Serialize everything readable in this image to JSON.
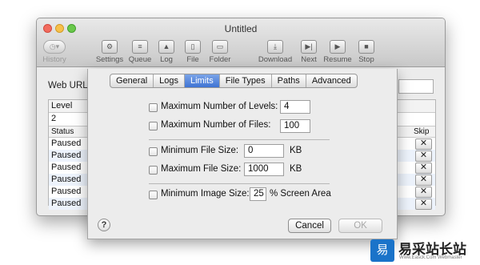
{
  "window": {
    "title": "Untitled"
  },
  "toolbar": {
    "history": "History",
    "settings": "Settings",
    "queue": "Queue",
    "log": "Log",
    "file": "File",
    "folder": "Folder",
    "download": "Download",
    "next": "Next",
    "resume": "Resume",
    "stop": "Stop"
  },
  "background": {
    "web_url_label": "Web URL:",
    "level_header": "Level",
    "level_value": "2",
    "status_header": "Status",
    "skip_header": "Skip",
    "rows": [
      "Paused",
      "Paused",
      "Paused",
      "Paused",
      "Paused",
      "Paused"
    ],
    "skip_glyph": "✕"
  },
  "sheet": {
    "tabs": [
      "General",
      "Logs",
      "Limits",
      "File Types",
      "Paths",
      "Advanced"
    ],
    "selected_tab": "Limits",
    "max_levels_label": "Maximum Number of Levels:",
    "max_levels_value": "4",
    "max_files_label": "Maximum Number of Files:",
    "max_files_value": "100",
    "min_file_size_label": "Minimum File Size:",
    "min_file_size_value": "0",
    "min_file_size_unit": "KB",
    "max_file_size_label": "Maximum File Size:",
    "max_file_size_value": "1000",
    "max_file_size_unit": "KB",
    "min_image_size_label": "Minimum Image Size:",
    "min_image_size_value": "25",
    "min_image_size_unit": "% Screen Area",
    "help_glyph": "?",
    "cancel_label": "Cancel",
    "ok_label": "OK"
  },
  "watermark": {
    "logo_glyph": "易",
    "title": "易采站长站",
    "subtitle": "Www.Easck.Com  Webmaster"
  }
}
